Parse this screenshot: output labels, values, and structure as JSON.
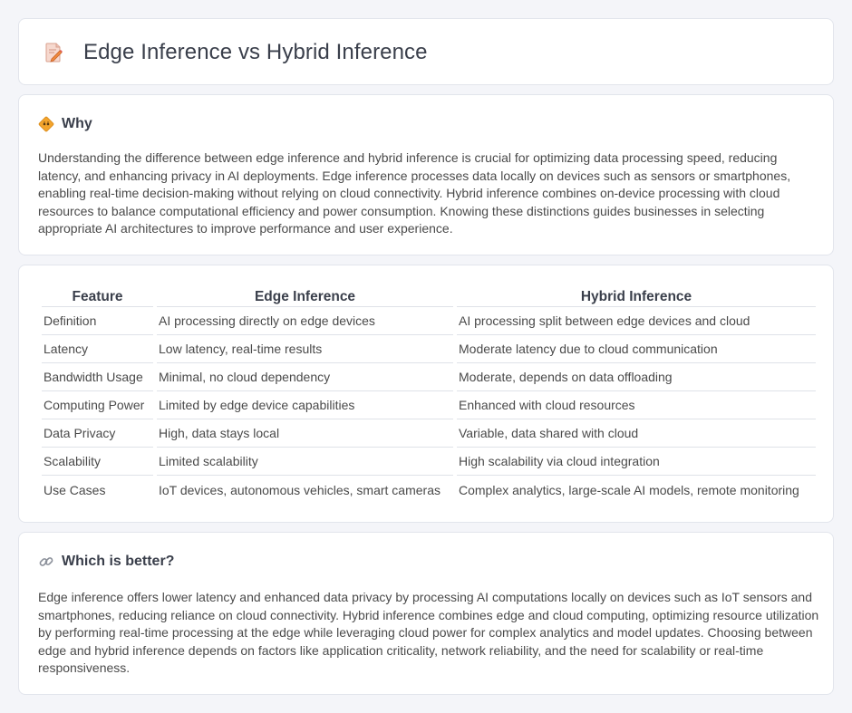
{
  "header": {
    "title": "Edge Inference vs Hybrid Inference",
    "icon": "document-pencil-icon"
  },
  "why": {
    "icon": "diamond-sign-icon",
    "title": "Why",
    "text": "Understanding the difference between edge inference and hybrid inference is crucial for optimizing data processing speed, reducing latency, and enhancing privacy in AI deployments. Edge inference processes data locally on devices such as sensors or smartphones, enabling real-time decision-making without relying on cloud connectivity. Hybrid inference combines on-device processing with cloud resources to balance computational efficiency and power consumption. Knowing these distinctions guides businesses in selecting appropriate AI architectures to improve performance and user experience."
  },
  "table": {
    "headers": [
      "Feature",
      "Edge Inference",
      "Hybrid Inference"
    ],
    "rows": [
      [
        "Definition",
        "AI processing directly on edge devices",
        "AI processing split between edge devices and cloud"
      ],
      [
        "Latency",
        "Low latency, real-time results",
        "Moderate latency due to cloud communication"
      ],
      [
        "Bandwidth Usage",
        "Minimal, no cloud dependency",
        "Moderate, depends on data offloading"
      ],
      [
        "Computing Power",
        "Limited by edge device capabilities",
        "Enhanced with cloud resources"
      ],
      [
        "Data Privacy",
        "High, data stays local",
        "Variable, data shared with cloud"
      ],
      [
        "Scalability",
        "Limited scalability",
        "High scalability via cloud integration"
      ],
      [
        "Use Cases",
        "IoT devices, autonomous vehicles, smart cameras",
        "Complex analytics, large-scale AI models, remote monitoring"
      ]
    ]
  },
  "better": {
    "icon": "link-icon",
    "title": "Which is better?",
    "text": "Edge inference offers lower latency and enhanced data privacy by processing AI computations locally on devices such as IoT sensors and smartphones, reducing reliance on cloud connectivity. Hybrid inference combines edge and cloud computing, optimizing resource utilization by performing real-time processing at the edge while leveraging cloud power for complex analytics and model updates. Choosing between edge and hybrid inference depends on factors like application criticality, network reliability, and the need for scalability or real-time responsiveness."
  },
  "colors": {
    "background": "#f4f5f9",
    "card": "#ffffff",
    "border": "#e2e5ec",
    "accent_orange": "#f0a030",
    "text": "#4a4a4a"
  }
}
